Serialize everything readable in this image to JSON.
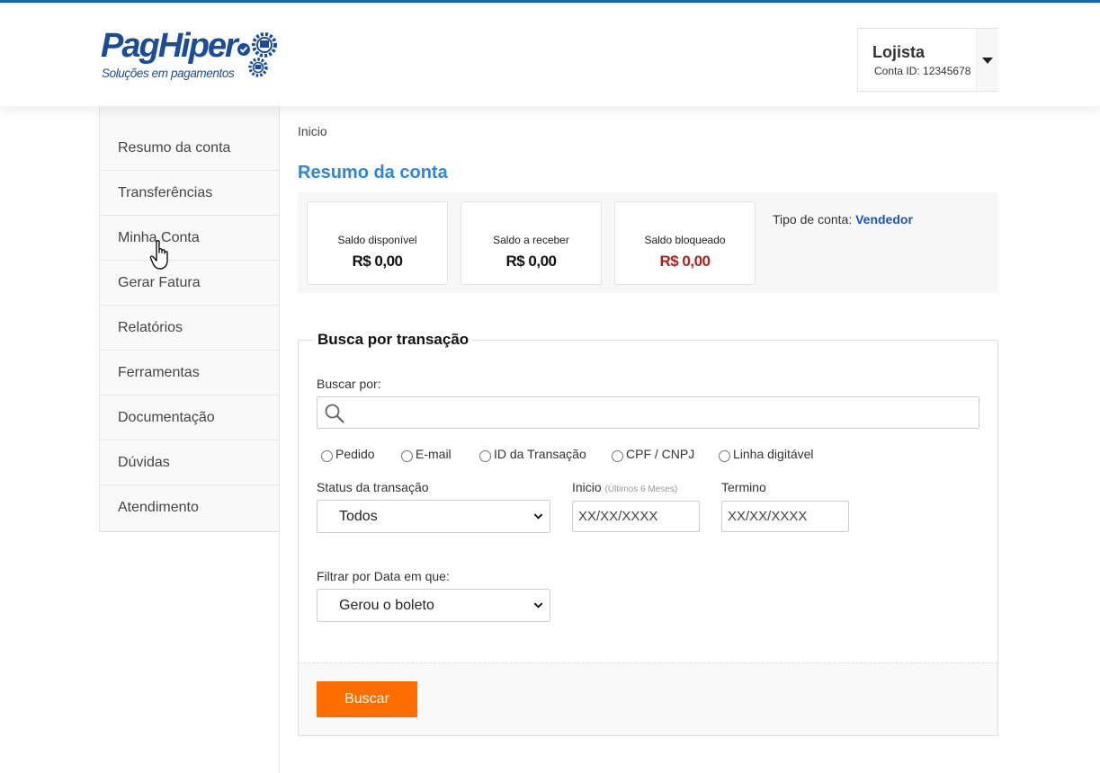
{
  "brand": {
    "name": "PagHiper",
    "tagline": "Soluções em pagamentos",
    "primary_color": "#1a4c99",
    "accent_color": "#ff6d00"
  },
  "user": {
    "name": "Lojista",
    "account_id": "Conta ID: 12345678"
  },
  "sidebar": {
    "items": [
      {
        "label": "Resumo da conta"
      },
      {
        "label": "Transferências"
      },
      {
        "label": "Minha Conta"
      },
      {
        "label": "Gerar Fatura"
      },
      {
        "label": "Relatórios"
      },
      {
        "label": "Ferramentas"
      },
      {
        "label": "Documentação"
      },
      {
        "label": "Dúvidas"
      },
      {
        "label": "Atendimento"
      }
    ]
  },
  "breadcrumb": "Inicio",
  "page_title": "Resumo da conta",
  "balances": [
    {
      "label": "Saldo disponível",
      "value": "R$ 0,00"
    },
    {
      "label": "Saldo a receber",
      "value": "R$ 0,00"
    },
    {
      "label": "Saldo bloqueado",
      "value": "R$ 0,00"
    }
  ],
  "account_type": {
    "label": "Tipo de conta: ",
    "value": "Vendedor"
  },
  "search": {
    "legend": "Busca por transação",
    "search_label": "Buscar por:",
    "search_value": "",
    "radio_options": [
      "Pedido",
      "E-mail",
      "ID da Transação",
      "CPF / CNPJ",
      "Linha digitável"
    ],
    "status_label": "Status da transação",
    "status_value": "Todos",
    "start_label": "Inicio",
    "start_hint": "(Últimos 6 Meses)",
    "start_placeholder": "XX/XX/XXXX",
    "end_label": "Termino",
    "end_placeholder": "XX/XX/XXXX",
    "filter_label": "Filtrar por Data em que:",
    "filter_value": "Gerou o boleto",
    "submit_label": "Buscar"
  }
}
